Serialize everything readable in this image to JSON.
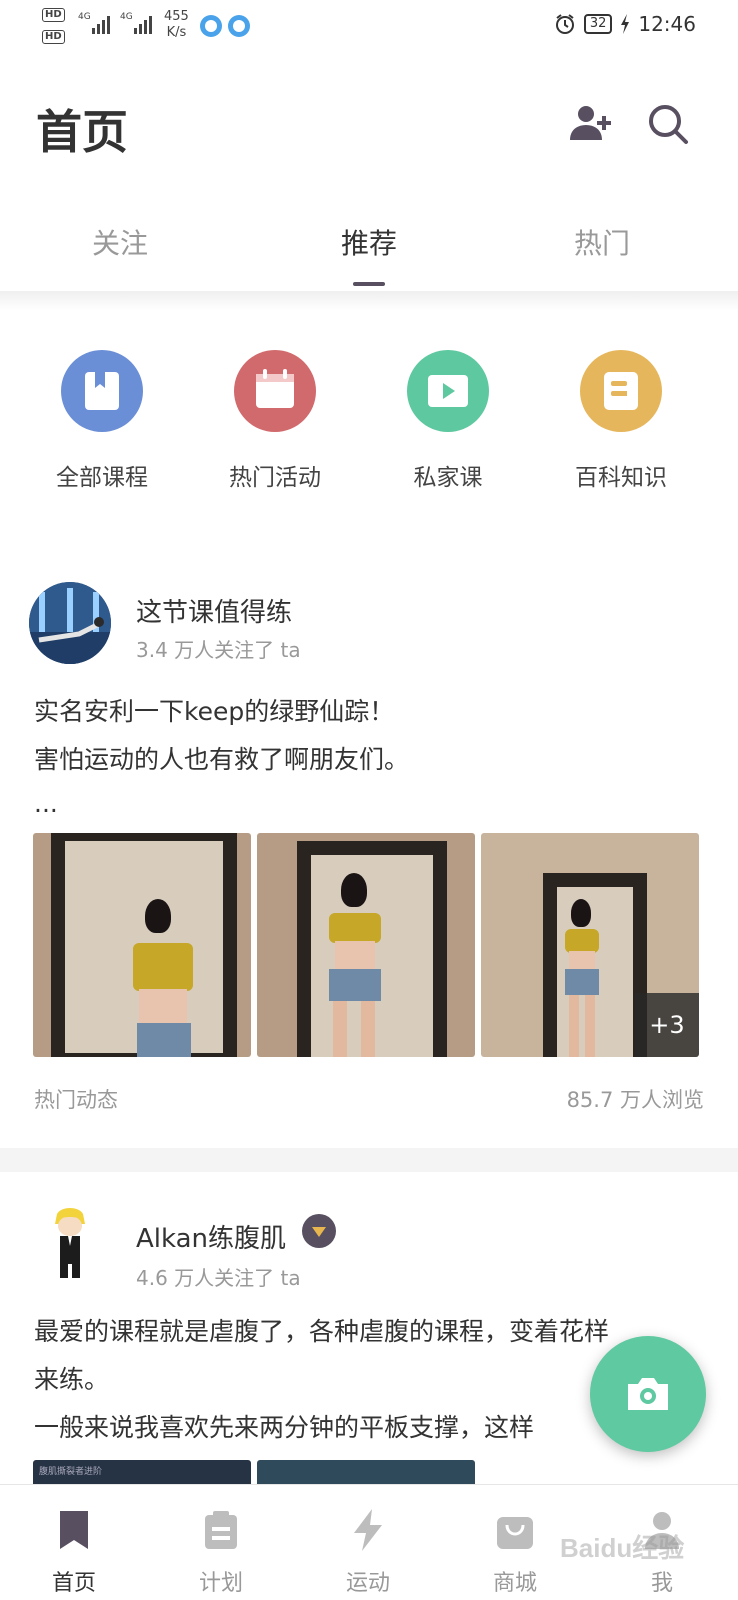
{
  "status_bar": {
    "hd1": "HD",
    "hd2": "HD",
    "net1": "4G",
    "net2": "4G",
    "speed_value": "455",
    "speed_unit": "K/s",
    "battery": "32",
    "time": "12:46"
  },
  "header": {
    "title": "首页",
    "add_friend_icon": "add-user-icon",
    "search_icon": "search-icon"
  },
  "tabs": [
    {
      "label": "关注",
      "active": false
    },
    {
      "label": "推荐",
      "active": true
    },
    {
      "label": "热门",
      "active": false
    }
  ],
  "categories": [
    {
      "label": "全部课程",
      "icon": "bookmark-icon",
      "color": "#6b8fd6"
    },
    {
      "label": "热门活动",
      "icon": "calendar-icon",
      "color": "#d16a6d"
    },
    {
      "label": "私家课",
      "icon": "video-icon",
      "color": "#5ec8a0"
    },
    {
      "label": "百科知识",
      "icon": "document-icon",
      "color": "#e6b65c"
    }
  ],
  "feed": [
    {
      "user": "这节课值得练",
      "followers": "3.4 万人关注了 ta",
      "text_lines": [
        "实名安利一下keep的绿野仙踪！",
        "害怕运动的人也有救了啊朋友们。",
        "..."
      ],
      "more_photos": "+3",
      "tag": "热门动态",
      "views": "85.7 万人浏览"
    },
    {
      "user": "Alkan练腹肌",
      "followers": "4.6 万人关注了 ta",
      "text_lines": [
        "最爱的课程就是虐腹了，各种虐腹的课程，变着花样",
        "来练。",
        "一般来说我喜欢先来两分钟的平板支撑，这样"
      ],
      "thumb_caption": "腹肌撕裂者进阶"
    }
  ],
  "fab": {
    "icon": "camera-icon"
  },
  "bottom_nav": [
    {
      "label": "首页",
      "icon": "home-bookmark-icon",
      "active": true
    },
    {
      "label": "计划",
      "icon": "plan-icon",
      "active": false
    },
    {
      "label": "运动",
      "icon": "lightning-icon",
      "active": false
    },
    {
      "label": "商城",
      "icon": "shop-bag-icon",
      "active": false
    },
    {
      "label": "我",
      "icon": "profile-icon",
      "active": false
    }
  ],
  "watermark": "Baidu经验"
}
